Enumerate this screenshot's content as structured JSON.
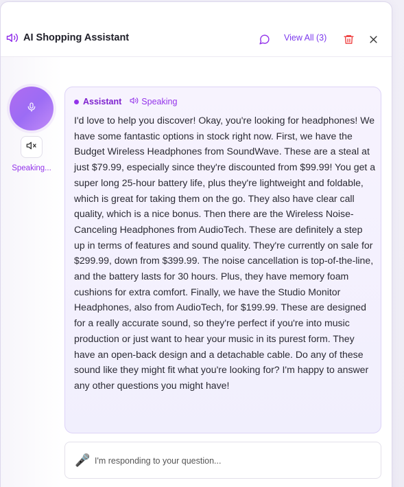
{
  "header": {
    "title": "AI Shopping Assistant",
    "view_all_label": "View All (3)",
    "icons": [
      "speaker-icon",
      "chat-bubble-icon",
      "trash-icon",
      "close-icon"
    ]
  },
  "left_rail": {
    "status_text": "Speaking...",
    "icons": [
      "microphone-icon",
      "mute-speaker-icon"
    ]
  },
  "message": {
    "sender": "Assistant",
    "state_label": "Speaking",
    "text": "I'd love to help you discover! Okay, you're looking for headphones! We have some fantastic options in stock right now. First, we have the Budget Wireless Headphones from SoundWave. These are a steal at just $79.99, especially since they're discounted from $99.99! You get a super long 25-hour battery life, plus they're lightweight and foldable, which is great for taking them on the go. They also have clear call quality, which is a nice bonus. Then there are the Wireless Noise-Canceling Headphones from AudioTech. These are definitely a step up in terms of features and sound quality. They're currently on sale for $299.99, down from $399.99. The noise cancellation is top-of-the-line, and the battery lasts for 30 hours. Plus, they have memory foam cushions for extra comfort. Finally, we have the Studio Monitor Headphones, also from AudioTech, for $199.99. These are designed for a really accurate sound, so they're perfect if you're into music production or just want to hear your music in its purest form. They have an open-back design and a detachable cable. Do any of these sound like they might fit what you're looking for? I'm happy to answer any other questions you might have!"
  },
  "input": {
    "mic_glyph": "🎤",
    "status_text": "I'm responding to your question..."
  },
  "colors": {
    "accent": "#9333ea",
    "accent_dark": "#7e22ce",
    "danger": "#ef4444",
    "bubble_bg": "#f4f1fe",
    "bubble_border": "#ddd3f7"
  }
}
